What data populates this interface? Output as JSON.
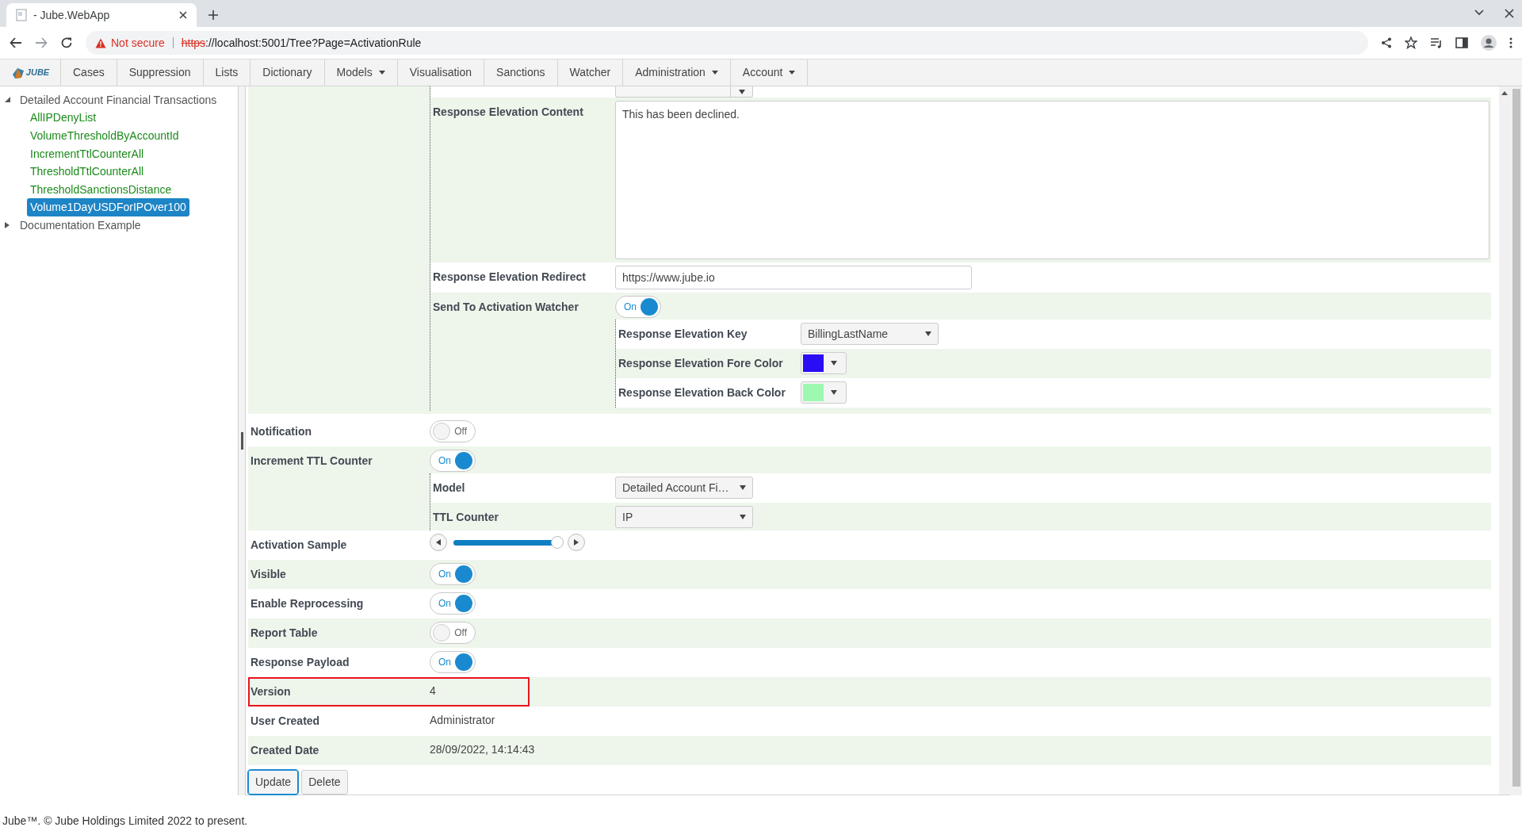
{
  "browser": {
    "tab_title": "- Jube.WebApp",
    "security": "Not secure",
    "url_scheme": "https",
    "url_rest": "://localhost:5001/Tree?Page=ActivationRule"
  },
  "nav": {
    "logo_text": "JUBE",
    "items": [
      {
        "label": "Cases",
        "dropdown": false
      },
      {
        "label": "Suppression",
        "dropdown": false
      },
      {
        "label": "Lists",
        "dropdown": false
      },
      {
        "label": "Dictionary",
        "dropdown": false
      },
      {
        "label": "Models",
        "dropdown": true
      },
      {
        "label": "Visualisation",
        "dropdown": false
      },
      {
        "label": "Sanctions",
        "dropdown": false
      },
      {
        "label": "Watcher",
        "dropdown": false
      },
      {
        "label": "Administration",
        "dropdown": true
      },
      {
        "label": "Account",
        "dropdown": true
      }
    ]
  },
  "tree": [
    {
      "label": "Detailed Account Financial Transactions",
      "expanded": true,
      "selected": false,
      "children": [
        {
          "label": "AllIPDenyList",
          "selected": false
        },
        {
          "label": "VolumeThresholdByAccountId",
          "selected": false
        },
        {
          "label": "IncrementTtlCounterAll",
          "selected": false
        },
        {
          "label": "ThresholdTtlCounterAll",
          "selected": false
        },
        {
          "label": "ThresholdSanctionsDistance",
          "selected": false
        },
        {
          "label": "Volume1DayUSDForIPOver100",
          "selected": true
        }
      ]
    },
    {
      "label": "Documentation Example",
      "expanded": false,
      "selected": false
    }
  ],
  "form": {
    "rows": [
      {
        "kind": "group",
        "children": [
          {
            "kind": "partial_select"
          },
          {
            "kind": "textarea",
            "label": "Response Elevation Content",
            "value": "This has been declined."
          },
          {
            "kind": "input",
            "label": "Response Elevation Redirect",
            "value": "https://www.jube.io"
          },
          {
            "kind": "toggle",
            "label": "Send To Activation Watcher",
            "on": true,
            "state_text": "On",
            "children": [
              {
                "kind": "select",
                "label": "Response Elevation Key",
                "value": "BillingLastName"
              },
              {
                "kind": "color",
                "label": "Response Elevation Fore Color",
                "color": "#2a0cf5"
              },
              {
                "kind": "color",
                "label": "Response Elevation Back Color",
                "color": "#9ef9b0"
              }
            ]
          }
        ]
      },
      {
        "kind": "toggle",
        "label": "Notification",
        "on": false,
        "state_text": "Off"
      },
      {
        "kind": "toggle",
        "label": "Increment TTL Counter",
        "on": true,
        "state_text": "On",
        "children": [
          {
            "kind": "select",
            "label": "Model",
            "value": "Detailed Account Fi…"
          },
          {
            "kind": "select",
            "label": "TTL Counter",
            "value": "IP"
          }
        ]
      },
      {
        "kind": "slider",
        "label": "Activation Sample",
        "level": 0.96
      },
      {
        "kind": "toggle",
        "label": "Visible",
        "on": true,
        "state_text": "On"
      },
      {
        "kind": "toggle",
        "label": "Enable Reprocessing",
        "on": true,
        "state_text": "On"
      },
      {
        "kind": "toggle",
        "label": "Report Table",
        "on": false,
        "state_text": "Off"
      },
      {
        "kind": "toggle",
        "label": "Response Payload",
        "on": true,
        "state_text": "On"
      },
      {
        "kind": "text",
        "label": "Version",
        "value": "4",
        "highlighted": true
      },
      {
        "kind": "text",
        "label": "User Created",
        "value": "Administrator",
        "highlighted": false
      },
      {
        "kind": "text",
        "label": "Created Date",
        "value": "28/09/2022, 14:14:43",
        "highlighted": false
      }
    ],
    "buttons": [
      {
        "label": "Update",
        "focused": true
      },
      {
        "label": "Delete",
        "focused": false
      }
    ]
  },
  "footer": "Jube™. © Jube Holdings Limited 2022 to present."
}
